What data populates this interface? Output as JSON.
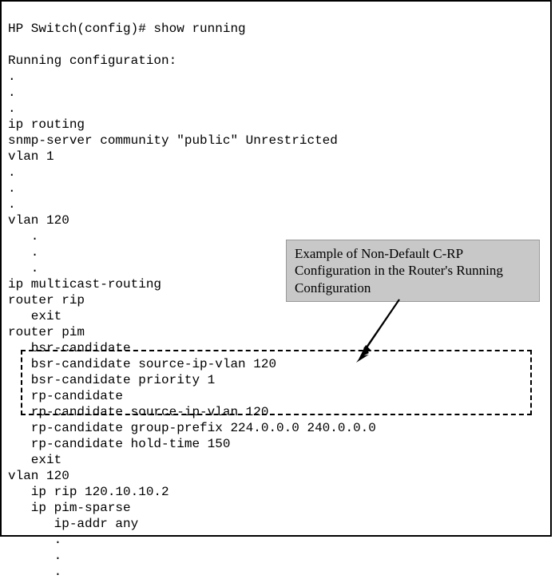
{
  "terminal": {
    "prompt_line": "HP Switch(config)# show running",
    "blank1": "",
    "header": "Running configuration:",
    "dot1": ".",
    "dot2": ".",
    "dot3": ".",
    "ip_routing": "ip routing",
    "snmp": "snmp-server community \"public\" Unrestricted",
    "vlan1": "vlan 1",
    "dot4": ".",
    "dot5": ".",
    "dot6": ".",
    "vlan120a": "vlan 120",
    "dot7": "   .",
    "dot8": "   .",
    "dot9": "   .",
    "ip_multicast": "ip multicast-routing",
    "router_rip": "router rip",
    "exit1": "   exit",
    "router_pim": "router pim",
    "bsr1": "   bsr-candidate",
    "bsr2": "   bsr-candidate source-ip-vlan 120",
    "bsr3": "   bsr-candidate priority 1",
    "rp1": "   rp-candidate",
    "rp2": "   rp-candidate source-ip-vlan 120",
    "rp3": "   rp-candidate group-prefix 224.0.0.0 240.0.0.0",
    "rp4": "   rp-candidate hold-time 150",
    "exit2": "   exit",
    "vlan120b": "vlan 120",
    "ip_rip": "   ip rip 120.10.10.2",
    "ip_pim": "   ip pim-sparse",
    "ip_addr": "      ip-addr any",
    "dot10": "      .",
    "dot11": "      .",
    "dot12": "      ."
  },
  "annotation": {
    "text": "Example of Non-Default C-RP Configuration in the Router's Running Configuration"
  }
}
